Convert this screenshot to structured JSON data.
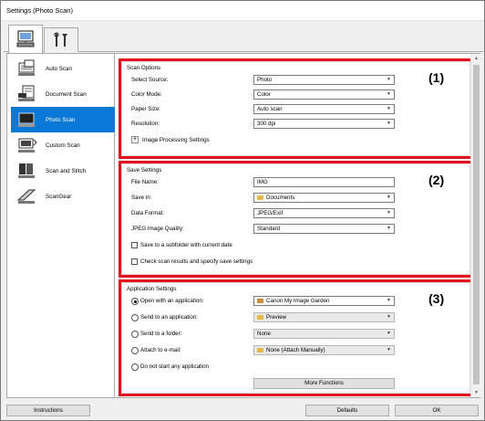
{
  "window": {
    "title": "Settings (Photo Scan)"
  },
  "tabs": [
    {
      "icon": "computer-scanner-icon"
    },
    {
      "icon": "tools-icon"
    }
  ],
  "sidebar": {
    "items": [
      {
        "label": "Auto Scan",
        "icon": "auto-scan-icon"
      },
      {
        "label": "Document Scan",
        "icon": "document-scan-icon"
      },
      {
        "label": "Photo Scan",
        "icon": "photo-scan-icon"
      },
      {
        "label": "Custom Scan",
        "icon": "custom-scan-icon"
      },
      {
        "label": "Scan and Stitch",
        "icon": "scan-and-stitch-icon"
      },
      {
        "label": "ScanGear",
        "icon": "scangear-icon"
      }
    ],
    "selected": "Photo Scan"
  },
  "scan_options": {
    "title": "Scan Options",
    "select_source": {
      "label": "Select Source:",
      "value": "Photo"
    },
    "color_mode": {
      "label": "Color Mode:",
      "value": "Color"
    },
    "paper_size": {
      "label": "Paper Size:",
      "value": "Auto scan"
    },
    "resolution": {
      "label": "Resolution:",
      "value": "300 dpi"
    },
    "image_processing": {
      "label": "Image Processing Settings",
      "expand_symbol": "+"
    }
  },
  "save_settings": {
    "title": "Save Settings",
    "file_name": {
      "label": "File Name:",
      "value": "IMG"
    },
    "save_in": {
      "label": "Save in:",
      "value": "Documents"
    },
    "data_format": {
      "label": "Data Format:",
      "value": "JPEG/Exif"
    },
    "jpeg_quality": {
      "label": "JPEG Image Quality:",
      "value": "Standard"
    },
    "subfolder": {
      "label": "Save to a subfolder with current date",
      "checked": false
    },
    "check_results": {
      "label": "Check scan results and specify save settings",
      "checked": false
    }
  },
  "application_settings": {
    "title": "Application Settings",
    "open_with": {
      "label": "Open with an application:",
      "value": "Canon My Image Garden",
      "selected": true
    },
    "send_to_app": {
      "label": "Send to an application:",
      "value": "Preview",
      "selected": false
    },
    "send_to_folder": {
      "label": "Send to a folder:",
      "value": "None",
      "selected": false
    },
    "attach_email": {
      "label": "Attach to e-mail:",
      "value": "None (Attach Manually)",
      "selected": false
    },
    "do_not_start": {
      "label": "Do not start any application",
      "selected": false
    },
    "more_functions": "More Functions"
  },
  "callouts": [
    "(1)",
    "(2)",
    "(3)"
  ],
  "footer": {
    "instructions": "Instructions",
    "defaults": "Defaults",
    "ok": "OK"
  },
  "colors": {
    "accent": "#0a78d7",
    "highlight_border": "#e0101f"
  }
}
